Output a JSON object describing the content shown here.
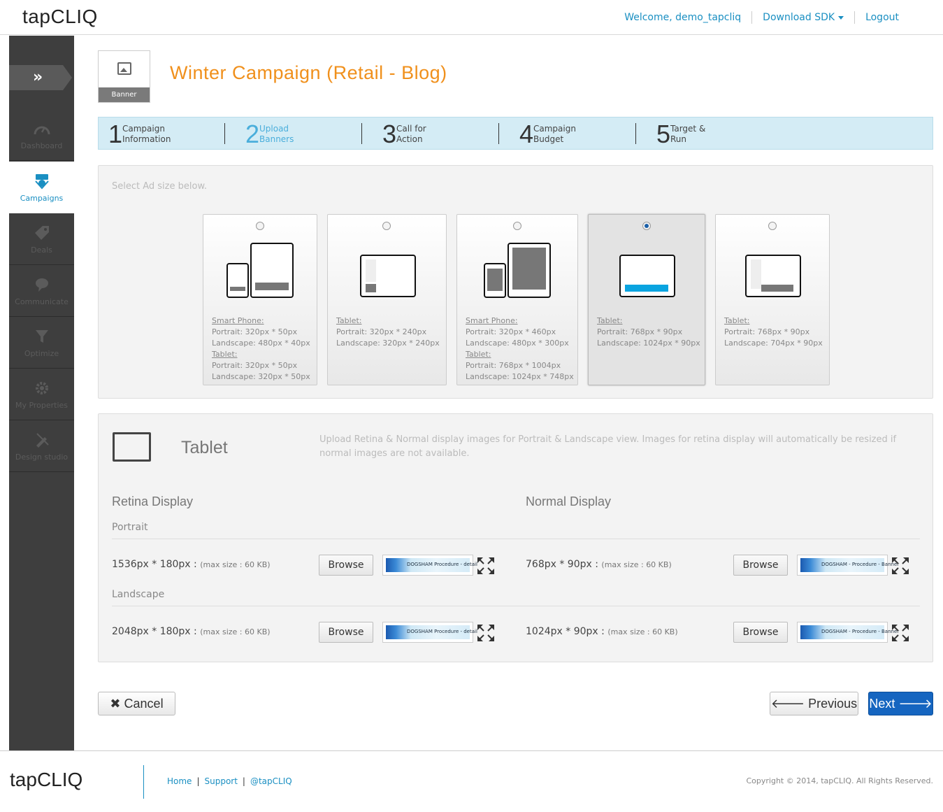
{
  "header": {
    "logo_a": "tap",
    "logo_b": "CLIQ",
    "welcome": "Welcome, demo_tapcliq",
    "download": "Download SDK",
    "logout": "Logout"
  },
  "sidebar": {
    "toggle": "»",
    "items": [
      {
        "label": "Dashboard",
        "icon": "speedometer-icon"
      },
      {
        "label": "Campaigns",
        "icon": "campaign-icon",
        "active": true
      },
      {
        "label": "Deals",
        "icon": "tag-icon"
      },
      {
        "label": "Communicate",
        "icon": "chat-icon"
      },
      {
        "label": "Optimize",
        "icon": "funnel-icon"
      },
      {
        "label": "My Properties",
        "icon": "gear-icon"
      },
      {
        "label": "Design studio",
        "icon": "design-icon"
      }
    ]
  },
  "campaign": {
    "type_label": "Banner",
    "title": "Winter Campaign (Retail - Blog)"
  },
  "steps": [
    {
      "num": "1",
      "line1": "Campaign",
      "line2": "Information"
    },
    {
      "num": "2",
      "line1": "Upload",
      "line2": "Banners"
    },
    {
      "num": "3",
      "line1": "Call for",
      "line2": "Action"
    },
    {
      "num": "4",
      "line1": "Campaign",
      "line2": "Budget"
    },
    {
      "num": "5",
      "line1": "Target &",
      "line2": "Run"
    }
  ],
  "ad_sizes": {
    "hint": "Select Ad size below.",
    "options": [
      {
        "lines": [
          "Smart Phone:",
          "Portrait: 320px * 50px",
          "Landscape: 480px * 40px",
          "Tablet:",
          "Portrait: 320px * 50px",
          "Landscape: 320px * 50px"
        ],
        "selected": false
      },
      {
        "lines": [
          "Tablet:",
          "Portrait: 320px * 240px",
          "Landscape: 320px * 240px"
        ],
        "selected": false
      },
      {
        "lines": [
          "Smart Phone:",
          "Portrait: 320px * 460px",
          "Landscape: 480px * 300px",
          "Tablet:",
          "Portrait: 768px * 1004px",
          "Landscape: 1024px * 748px"
        ],
        "selected": false
      },
      {
        "lines": [
          "Tablet:",
          "Portrait: 768px * 90px",
          "Landscape: 1024px * 90px"
        ],
        "selected": true
      },
      {
        "lines": [
          "Tablet:",
          "Portrait: 768px * 90px",
          "Landscape: 704px * 90px"
        ],
        "selected": false
      }
    ]
  },
  "upload": {
    "device": "Tablet",
    "info": "Upload Retina & Normal display images for Portrait & Landscape view. Images for retina display will automatically be resized if normal images are not available.",
    "retina_heading": "Retina Display",
    "normal_heading": "Normal Display",
    "portrait_label": "Portrait",
    "landscape_label": "Landscape",
    "browse": "Browse",
    "max_size": "(max size : 60 KB)",
    "thumb_text": "DOGSHAM  Procedure  - detail",
    "thumb_text2": "DOGSHAM  - Procedure - Banner",
    "retina_portrait": "1536px * 180px :",
    "normal_portrait": "768px * 90px :",
    "retina_landscape": "2048px * 180px :",
    "normal_landscape": "1024px * 90px :"
  },
  "actions": {
    "cancel": "Cancel",
    "previous": "Previous",
    "next": "Next"
  },
  "footer": {
    "logo_a": "tap",
    "logo_b": "CLIQ",
    "home": "Home",
    "support": "Support",
    "twitter": "@tapCLIQ",
    "copyright": "Copyright © 2014, tapCLIQ. All Rights Reserved."
  }
}
